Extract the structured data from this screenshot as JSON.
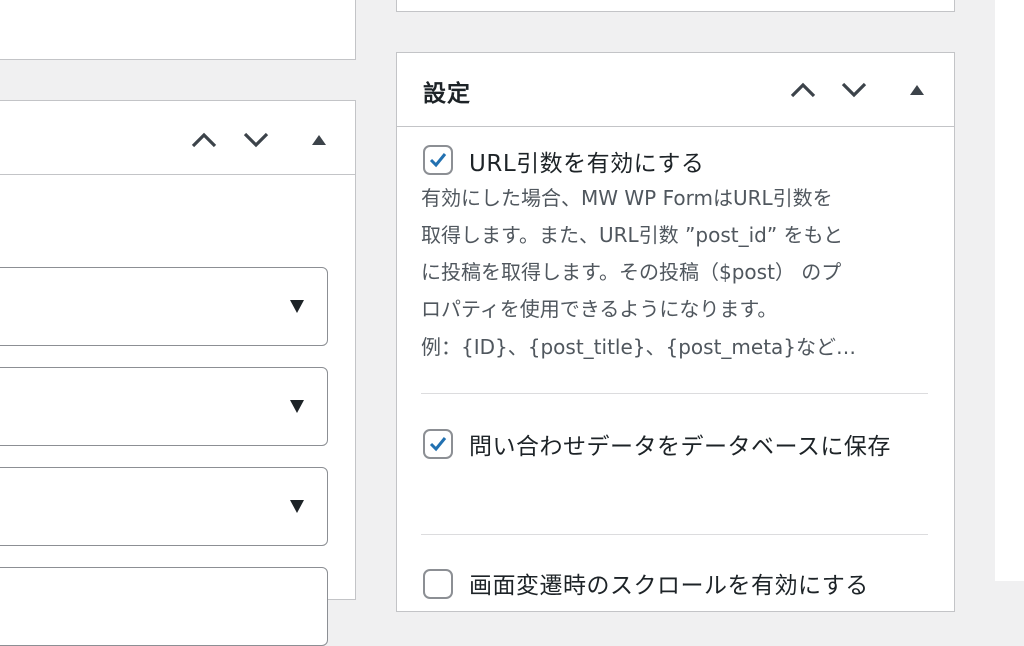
{
  "settings_panel": {
    "title": "設定",
    "options": [
      {
        "label": "URL引数を有効にする",
        "checked": true,
        "description": [
          "有効にした場合、MW WP FormはURL引数を",
          "取得します。また、URL引数 ”post_id” をもと",
          "に投稿を取得します。その投稿（$post） のプ",
          "ロパティを使用できるようになります。"
        ],
        "example": "例：{ID}、{post_title}、{post_meta}など…"
      },
      {
        "label": "問い合わせデータをデータベースに保存",
        "checked": true
      },
      {
        "label": "画面変遷時のスクロールを有効にする",
        "checked": false
      }
    ]
  },
  "icons": {
    "move_up": "chevron-up-icon",
    "move_down": "chevron-down-icon",
    "toggle_panel": "triangle-up-icon",
    "select_dropdown": "triangle-down-icon",
    "checkbox_check": "checkmark-icon"
  },
  "colors": {
    "checkbox_check": "#2271b1",
    "border": "#c3c4c7",
    "background": "#f0f0f1"
  }
}
